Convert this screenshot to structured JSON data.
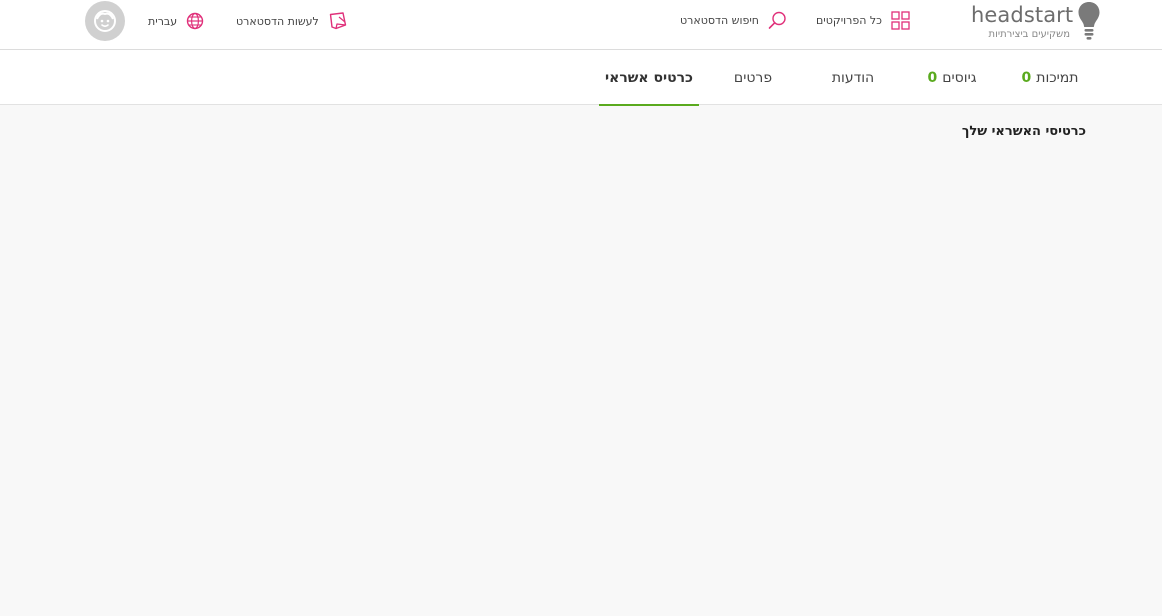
{
  "header": {
    "logo_text": "headstart",
    "logo_tagline": "משקיעים ביצירתיות",
    "all_projects_label": "כל הפרויקטים",
    "search_label": "חיפוש הדסטארט",
    "create_label": "לעשות הדסטארט",
    "language_label": "עברית"
  },
  "tabs": [
    {
      "label": "תמיכות",
      "count": "0"
    },
    {
      "label": "גיוסים",
      "count": "0"
    },
    {
      "label": "הודעות"
    },
    {
      "label": "פרטים"
    },
    {
      "label": "כרטיס אשראי",
      "active": true
    }
  ],
  "main": {
    "section_title": "כרטיסי האשראי שלך"
  },
  "colors": {
    "accent_pink": "#e0307a",
    "accent_green": "#5aaa1e",
    "logo_gray": "#6d6d6d",
    "background": "#f8f8f8"
  }
}
